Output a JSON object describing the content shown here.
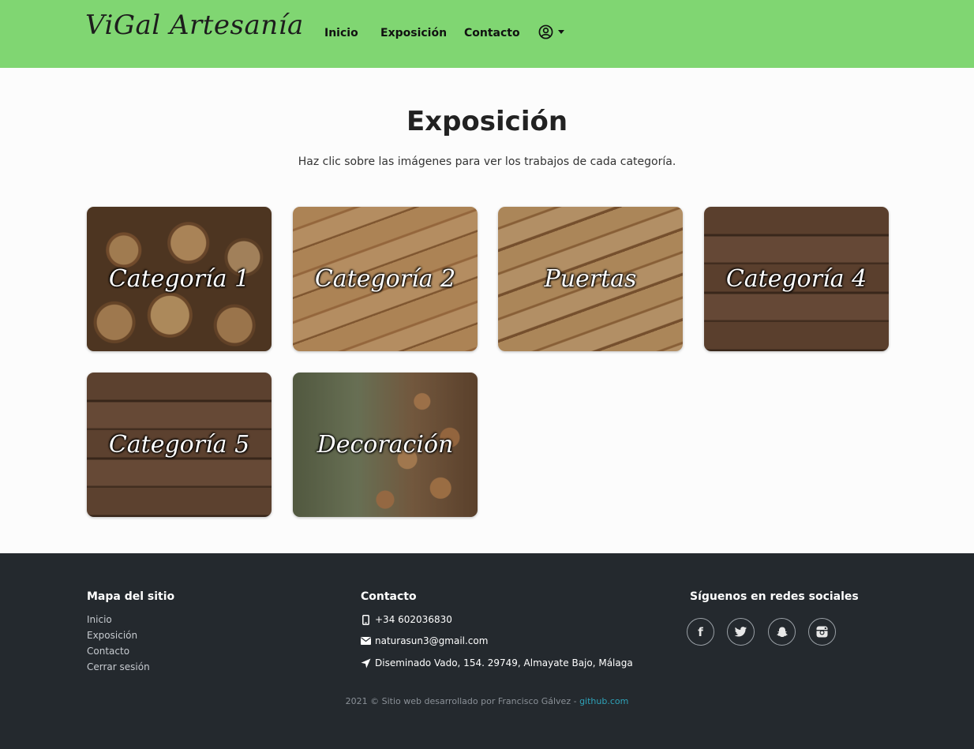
{
  "navbar": {
    "brand": "ViGal Artesanía",
    "links": [
      "Inicio",
      "Exposición",
      "Contacto"
    ],
    "background": "#80d672"
  },
  "main": {
    "title": "Exposición",
    "subtitle": "Haz clic sobre las imágenes para ver los trabajos de cada categoría.",
    "cards": [
      {
        "label": "Categoría 1"
      },
      {
        "label": "Categoría 2"
      },
      {
        "label": "Puertas"
      },
      {
        "label": "Categoría 4"
      },
      {
        "label": "Categoría 5"
      },
      {
        "label": "Decoración"
      }
    ]
  },
  "footer": {
    "sitemap_title": "Mapa del sitio",
    "sitemap_links": [
      "Inicio",
      "Exposición",
      "Contacto",
      "Cerrar sesión"
    ],
    "contact_title": "Contacto",
    "phone": "+34 602036830",
    "email": "naturasun3@gmail.com",
    "address": "Diseminado Vado, 154. 29749, Almayate Bajo, Málaga",
    "social_title": "Síguenos en redes sociales",
    "social_icons": [
      "facebook-icon",
      "twitter-icon",
      "snapchat-icon",
      "instagram-icon"
    ],
    "copyright": "2021 © Sitio web desarrollado por Francisco Gálvez - ",
    "github": "github.com",
    "background": "#24292e"
  }
}
